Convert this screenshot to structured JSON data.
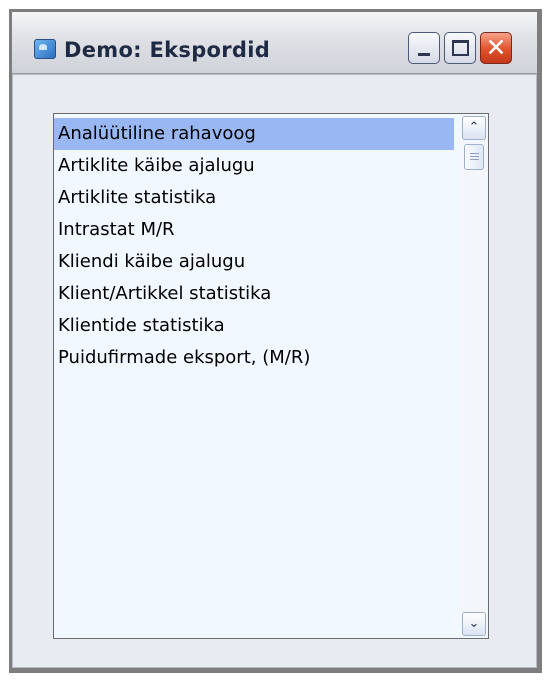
{
  "window": {
    "title": "Demo: Ekspordid",
    "app_icon": "app-icon",
    "controls": {
      "minimize_icon": "minimize-icon",
      "maximize_icon": "maximize-icon",
      "close_icon": "close-icon",
      "close_glyph": "✕"
    }
  },
  "list": {
    "items": [
      {
        "label": "Analüütiline rahavoog",
        "selected": true
      },
      {
        "label": "Artiklite käibe ajalugu",
        "selected": false
      },
      {
        "label": "Artiklite statistika",
        "selected": false
      },
      {
        "label": "Intrastat M/R",
        "selected": false
      },
      {
        "label": "Kliendi käibe ajalugu",
        "selected": false
      },
      {
        "label": "Klient/Artikkel statistika",
        "selected": false
      },
      {
        "label": "Klientide statistika",
        "selected": false
      },
      {
        "label": "Puidufirmade eksport, (M/R)",
        "selected": false
      }
    ],
    "scrollbar": {
      "up_icon": "chevron-up-icon",
      "down_icon": "chevron-down-icon",
      "up_glyph": "⌃",
      "down_glyph": "⌄"
    }
  },
  "colors": {
    "selection": "#98b7f3",
    "list_background": "#f2f8ff",
    "client_background": "#e8ebf1",
    "close_button": "#e0512b"
  }
}
